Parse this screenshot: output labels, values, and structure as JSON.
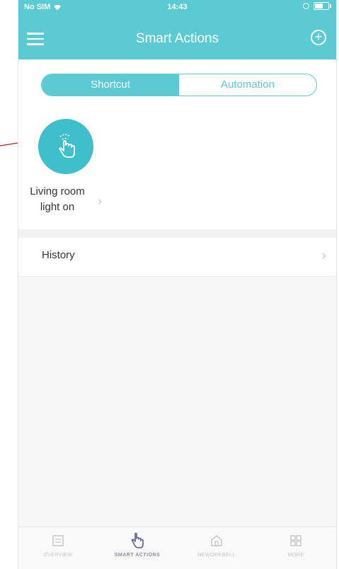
{
  "status_bar": {
    "carrier": "No SIM",
    "time": "14:43"
  },
  "nav": {
    "title": "Smart Actions"
  },
  "segmented": {
    "shortcut_label": "Shortcut",
    "automation_label": "Automation"
  },
  "shortcut": {
    "line1": "Living room",
    "line2": "light on"
  },
  "history": {
    "label": "History"
  },
  "tabs": [
    {
      "label": "OVERVIEW",
      "icon": "overview-icon"
    },
    {
      "label": "SMART ACTIONS",
      "icon": "smart-actions-icon"
    },
    {
      "label": "NEWORKBELL",
      "icon": "home-icon"
    },
    {
      "label": "MORE",
      "icon": "grid-icon"
    }
  ],
  "colors": {
    "accent": "#5ccad3",
    "shortcut_circle": "#3fbfca",
    "annotation": "#b22222"
  }
}
